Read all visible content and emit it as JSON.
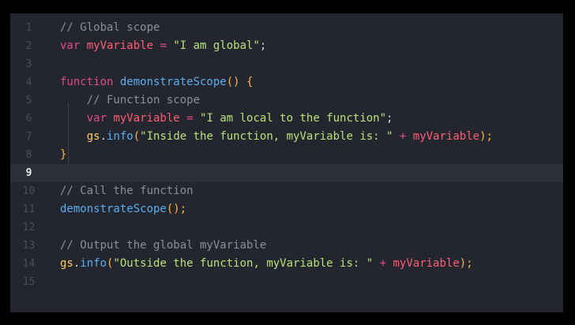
{
  "editor": {
    "active_line": 9,
    "lines": [
      {
        "num": "1",
        "tokens": [
          {
            "t": "// Global scope",
            "c": "comment"
          }
        ]
      },
      {
        "num": "2",
        "tokens": [
          {
            "t": "var ",
            "c": "keyword"
          },
          {
            "t": "myVariable",
            "c": "var"
          },
          {
            "t": " = ",
            "c": "op"
          },
          {
            "t": "\"I am global\"",
            "c": "string"
          },
          {
            "t": ";",
            "c": "punct"
          }
        ]
      },
      {
        "num": "3",
        "tokens": []
      },
      {
        "num": "4",
        "tokens": [
          {
            "t": "function ",
            "c": "keyword"
          },
          {
            "t": "demonstrateScope",
            "c": "func"
          },
          {
            "t": "() {",
            "c": "brace"
          }
        ]
      },
      {
        "num": "5",
        "tokens": [
          {
            "t": "    // Function scope",
            "c": "comment"
          }
        ]
      },
      {
        "num": "6",
        "tokens": [
          {
            "t": "    var ",
            "c": "keyword"
          },
          {
            "t": "myVariable",
            "c": "var"
          },
          {
            "t": " = ",
            "c": "op"
          },
          {
            "t": "\"I am local to the function\"",
            "c": "string"
          },
          {
            "t": ";",
            "c": "punct"
          }
        ]
      },
      {
        "num": "7",
        "tokens": [
          {
            "t": "    gs",
            "c": "obj"
          },
          {
            "t": ".",
            "c": "punct"
          },
          {
            "t": "info",
            "c": "func"
          },
          {
            "t": "(",
            "c": "brace"
          },
          {
            "t": "\"Inside the function, myVariable is: \"",
            "c": "string"
          },
          {
            "t": " + ",
            "c": "op"
          },
          {
            "t": "myVariable",
            "c": "var"
          },
          {
            "t": ");",
            "c": "brace"
          }
        ]
      },
      {
        "num": "8",
        "tokens": [
          {
            "t": "}",
            "c": "brace"
          }
        ]
      },
      {
        "num": "9",
        "tokens": []
      },
      {
        "num": "10",
        "tokens": [
          {
            "t": "// Call the function",
            "c": "comment"
          }
        ]
      },
      {
        "num": "11",
        "tokens": [
          {
            "t": "demonstrateScope",
            "c": "func"
          },
          {
            "t": "();",
            "c": "brace"
          }
        ]
      },
      {
        "num": "12",
        "tokens": []
      },
      {
        "num": "13",
        "tokens": [
          {
            "t": "// Output the global myVariable",
            "c": "comment"
          }
        ]
      },
      {
        "num": "14",
        "tokens": [
          {
            "t": "gs",
            "c": "obj"
          },
          {
            "t": ".",
            "c": "punct"
          },
          {
            "t": "info",
            "c": "func"
          },
          {
            "t": "(",
            "c": "brace"
          },
          {
            "t": "\"Outside the function, myVariable is: \"",
            "c": "string"
          },
          {
            "t": " + ",
            "c": "op"
          },
          {
            "t": "myVariable",
            "c": "var"
          },
          {
            "t": ");",
            "c": "brace"
          }
        ]
      },
      {
        "num": "15",
        "tokens": []
      }
    ]
  }
}
